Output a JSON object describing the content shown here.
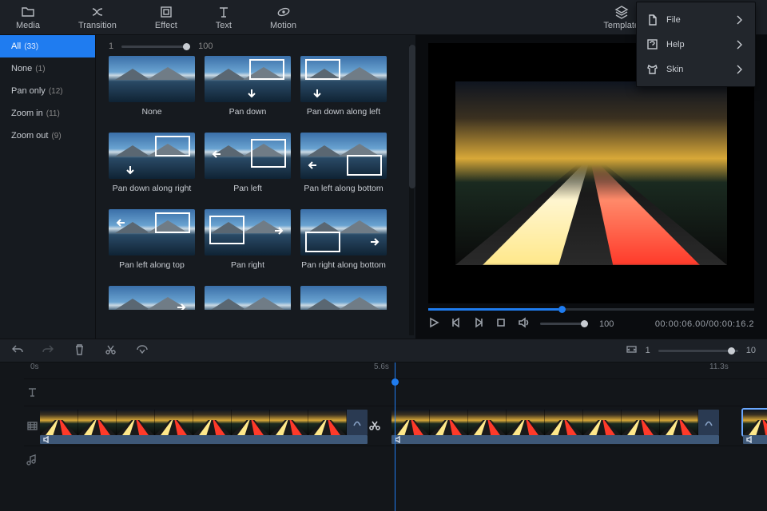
{
  "topbar": {
    "tabs": [
      {
        "label": "Media"
      },
      {
        "label": "Transition"
      },
      {
        "label": "Effect"
      },
      {
        "label": "Text"
      },
      {
        "label": "Motion"
      }
    ],
    "right": [
      {
        "label": "Template"
      }
    ]
  },
  "dropdown": {
    "items": [
      {
        "label": "File"
      },
      {
        "label": "Help"
      },
      {
        "label": "Skin"
      }
    ]
  },
  "sidebar": {
    "items": [
      {
        "label": "All",
        "count": "(33)",
        "selected": true
      },
      {
        "label": "None",
        "count": "(1)"
      },
      {
        "label": "Pan only",
        "count": "(12)"
      },
      {
        "label": "Zoom in",
        "count": "(11)"
      },
      {
        "label": "Zoom out",
        "count": "(9)"
      }
    ]
  },
  "sizer": {
    "min": "1",
    "max": "100"
  },
  "effects": [
    {
      "label": "None",
      "overlay": "none"
    },
    {
      "label": "Pan down",
      "overlay": "pd"
    },
    {
      "label": "Pan down along left",
      "overlay": "pdl"
    },
    {
      "label": "Pan down along right",
      "overlay": "pdr"
    },
    {
      "label": "Pan left",
      "overlay": "pl"
    },
    {
      "label": "Pan left along bottom",
      "overlay": "plb"
    },
    {
      "label": "Pan left along top",
      "overlay": "plt"
    },
    {
      "label": "Pan right",
      "overlay": "pr"
    },
    {
      "label": "Pan right along bottom",
      "overlay": "prb"
    },
    {
      "label": "",
      "overlay": "x1"
    },
    {
      "label": "",
      "overlay": "x2"
    },
    {
      "label": "",
      "overlay": "x3"
    }
  ],
  "preview": {
    "volume": "100",
    "time_current": "00:00:06.00",
    "time_total": "00:00:16.2"
  },
  "zoom": {
    "min": "1",
    "max": "10"
  },
  "ruler": {
    "t0": "0s",
    "t1": "5.6s",
    "t2": "11.3s"
  }
}
